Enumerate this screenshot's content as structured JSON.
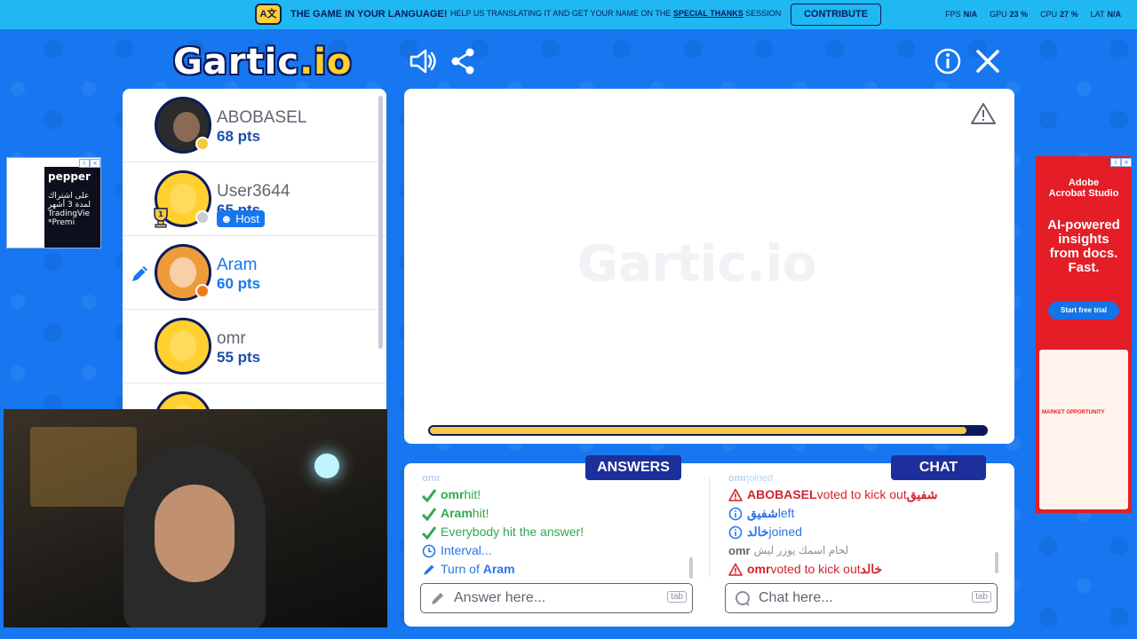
{
  "topbar": {
    "lang_icon_text": "A文",
    "headline": "THE GAME IN YOUR LANGUAGE!",
    "sub_pre": "HELP US TRANSLATING IT AND GET YOUR NAME ON THE ",
    "sub_link": "SPECIAL THANKS",
    "sub_post": " SESSION",
    "contribute_label": "CONTRIBUTE",
    "stats": {
      "fps_label": "FPS",
      "fps_value": "N/A",
      "gpu_label": "GPU",
      "gpu_value": "23 %",
      "cpu_label": "CPU",
      "cpu_value": "27 %",
      "lat_label": "LAT",
      "lat_value": "N/A"
    }
  },
  "logo": {
    "main": "Gartic",
    "suffix": ".io"
  },
  "players": [
    {
      "name": "ABOBASEL",
      "points": "68 pts",
      "status_color": "#f5c842",
      "avatar": "photo"
    },
    {
      "name": "User3644",
      "points": "65 pts",
      "status_color": "#c7cbd3",
      "avatar": "default",
      "host_label": "Host",
      "trophy": "1"
    },
    {
      "name": "Aram",
      "points": "60 pts",
      "status_color": "#ee7b1a",
      "avatar": "drawing-char",
      "is_drawing": true
    },
    {
      "name": "omr",
      "points": "55 pts",
      "status_color": "#c7cbd3",
      "avatar": "default"
    }
  ],
  "canvas": {
    "watermark": "Gartic.io",
    "timer_fraction": 0.965
  },
  "answers": {
    "tab_label": "ANSWERS",
    "messages": [
      {
        "type": "faded",
        "user": "omr",
        "text": ""
      },
      {
        "type": "hit",
        "user": "omr",
        "text": " hit!"
      },
      {
        "type": "hit",
        "user": "Aram",
        "text": " hit!"
      },
      {
        "type": "hit",
        "user": "",
        "text": "Everybody hit the answer!"
      },
      {
        "type": "info",
        "user": "",
        "text": "Interval..."
      },
      {
        "type": "turn",
        "user": "Aram",
        "text": "Turn of "
      }
    ],
    "placeholder": "Answer here...",
    "tab_hint": "tab"
  },
  "chat": {
    "tab_label": "CHAT",
    "messages": [
      {
        "type": "faded",
        "user": "omr",
        "text": " joined"
      },
      {
        "type": "warn",
        "user": "ABOBASEL",
        "text": " voted to kick out ",
        "target": "شفيق"
      },
      {
        "type": "info",
        "user": "شفيق",
        "text": " left"
      },
      {
        "type": "info",
        "user": "خالد",
        "text": " joined"
      },
      {
        "type": "chat",
        "user": "omr",
        "text": "لحام اسمك يوزر ليش"
      },
      {
        "type": "warn",
        "user": "omr",
        "text": " voted to kick out ",
        "target": "خالد"
      }
    ],
    "placeholder": "Chat here...",
    "tab_hint": "tab"
  },
  "ads": {
    "left": {
      "brand": "pepper",
      "line1": "على اشتراك",
      "line2": "لمدة 3 أشهر",
      "line3": "TradingVie",
      "line4": "*Premi"
    },
    "right": {
      "brand_line1": "Adobe",
      "brand_line2": "Acrobat Studio",
      "headline": "AI-powered insights from docs. Fast.",
      "cta": "Start free trial",
      "mock_label": "MARKET OPPORTUNITY"
    }
  },
  "colors": {
    "background": "#1677f0",
    "topbar": "#1fb8f2",
    "navy": "#0d1a5a",
    "hit_green": "#2fa84f",
    "warn_red": "#d4242f",
    "info_blue": "#2a76e6",
    "timer_yellow": "#f5c842"
  }
}
